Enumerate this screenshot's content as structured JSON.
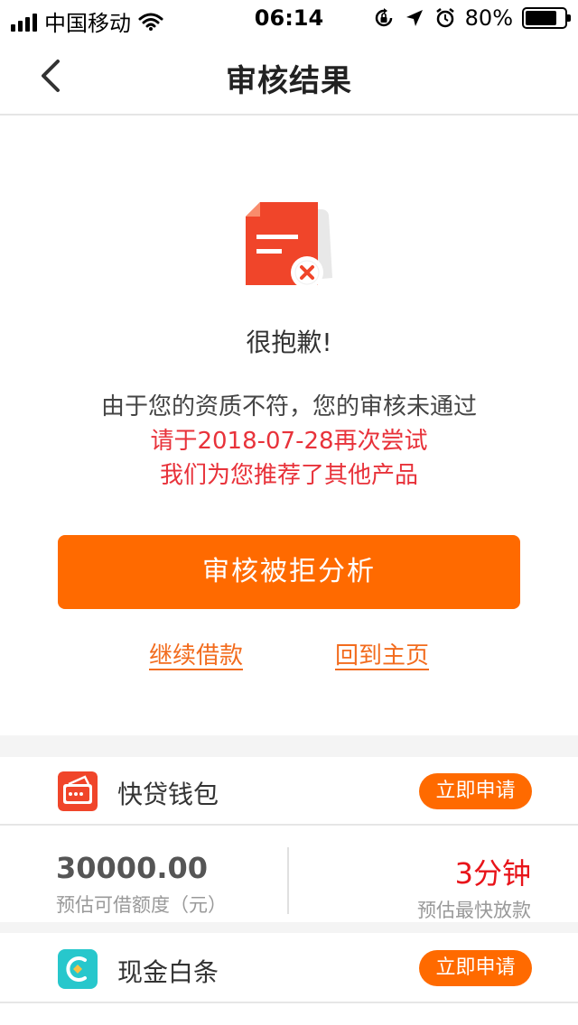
{
  "status_bar": {
    "carrier": "中国移动",
    "time": "06:14",
    "battery": "80%",
    "battery_level": 0.8
  },
  "nav": {
    "title": "审核结果",
    "back_icon": "chevron-left-icon"
  },
  "result": {
    "icon": "rejected-document-icon",
    "sorry": "很抱歉!",
    "message_line1": "由于您的资质不符，您的审核未通过",
    "message_line2": "请于2018-07-28再次尝试",
    "message_line3": "我们为您推荐了其他产品",
    "accent_color": "#e8323a"
  },
  "actions": {
    "analysis_button": "审核被拒分析",
    "continue_link": "继续借款",
    "home_link": "回到主页",
    "primary_color": "#ff6a00"
  },
  "products": [
    {
      "name": "快贷钱包",
      "icon": "wallet-icon",
      "apply_label": "立即申请",
      "amount": "30000.00",
      "amount_label": "预估可借额度（元）",
      "speed": "3分钟",
      "speed_label": "预估最快放款"
    },
    {
      "name": "现金白条",
      "icon": "cash-loop-icon",
      "apply_label": "立即申请"
    }
  ]
}
